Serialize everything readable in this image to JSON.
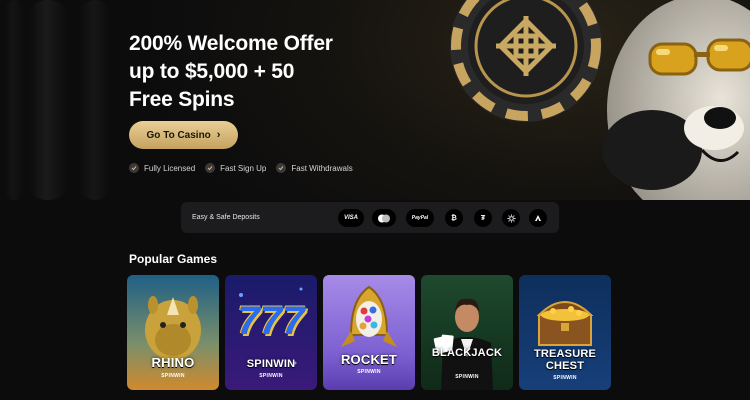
{
  "hero": {
    "title_lines": [
      "200% Welcome Offer",
      "up to $5,000 + 50",
      "Free Spins"
    ],
    "cta_label": "Go To Casino",
    "features": [
      "Fully Licensed",
      "Fast Sign Up",
      "Fast Withdrawals"
    ]
  },
  "deposits": {
    "label": "Easy & Safe Deposits",
    "methods": [
      {
        "label": "VISA",
        "icon": "visa-icon"
      },
      {
        "label": "",
        "icon": "mastercard-icon"
      },
      {
        "label": "PayPal",
        "icon": "paypal-icon"
      },
      {
        "label": "₿",
        "icon": "bitcoin-icon"
      },
      {
        "label": "₮",
        "icon": "tether-icon"
      },
      {
        "label": "",
        "icon": "sun-coin-icon"
      },
      {
        "label": "",
        "icon": "triangle-coin-icon"
      }
    ]
  },
  "games_section": {
    "title": "Popular Games",
    "games": [
      {
        "name": "RHINO",
        "brand": "SPINWIN"
      },
      {
        "name": "SPINWIN",
        "brand": "SPINWIN",
        "art_text": "777"
      },
      {
        "name": "ROCKET",
        "brand": "SPINWIN"
      },
      {
        "name": "BLACKJACK",
        "brand": "SPINWIN"
      },
      {
        "name_line1": "TREASURE",
        "name_line2": "CHEST",
        "brand": "SPINWIN"
      }
    ]
  },
  "colors": {
    "accent_gold": "#d9b979",
    "background": "#0c0c0d",
    "panel": "#1c1c1e"
  }
}
